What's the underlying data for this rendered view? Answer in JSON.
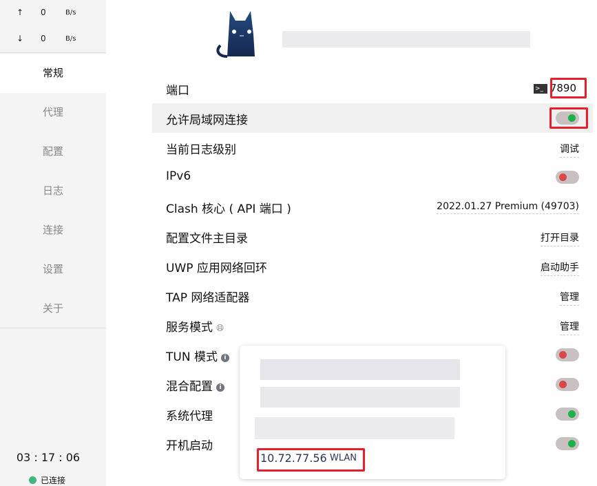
{
  "traffic": {
    "up_arrow": "↑",
    "up_value": "0",
    "up_unit": "B/s",
    "down_arrow": "↓",
    "down_value": "0",
    "down_unit": "B/s"
  },
  "sidebar": {
    "items": [
      {
        "label": "常规",
        "active": true
      },
      {
        "label": "代理"
      },
      {
        "label": "配置"
      },
      {
        "label": "日志"
      },
      {
        "label": "连接"
      },
      {
        "label": "设置"
      },
      {
        "label": "关于"
      }
    ]
  },
  "footer": {
    "uptime": "03 : 17 : 06",
    "status": "已连接",
    "status_color": "#3fb77f"
  },
  "settings": [
    {
      "label": "端口",
      "value": "7890",
      "icon": "terminal-icon"
    },
    {
      "label": "允许局域网连接",
      "toggle": true
    },
    {
      "label": "当前日志级别",
      "value": "调试"
    },
    {
      "label": "IPv6",
      "toggle": false
    },
    {
      "label": "Clash 核心 ( API 端口 )",
      "value": "2022.01.27 Premium (49703)"
    },
    {
      "label": "配置文件主目录",
      "value": "打开目录"
    },
    {
      "label": "UWP 应用网络回环",
      "value": "启动助手"
    },
    {
      "label": "TAP 网络适配器",
      "value": "管理"
    },
    {
      "label": "服务模式",
      "value": "管理",
      "icon": "globe-icon"
    },
    {
      "label": "TUN 模式",
      "toggle": false,
      "icon": "info-icon"
    },
    {
      "label": "混合配置",
      "toggle": false,
      "icon": "info-icon"
    },
    {
      "label": "系统代理",
      "toggle": true
    },
    {
      "label": "开机启动",
      "toggle": true
    }
  ],
  "popup": {
    "ip": "10.72.77.56",
    "interface": "WLAN"
  },
  "colors": {
    "toggle_on": "#1db148",
    "toggle_off": "#d9474a",
    "highlight": "#e6202a"
  }
}
